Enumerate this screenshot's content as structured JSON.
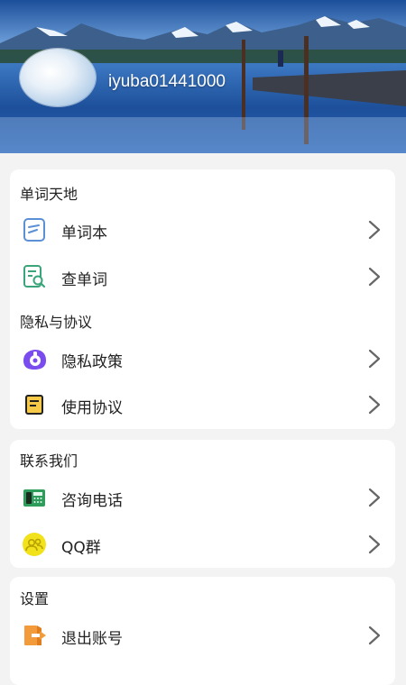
{
  "profile": {
    "username": "iyuba01441000"
  },
  "sections": [
    {
      "title": "单词天地",
      "items": [
        {
          "label": "单词本",
          "icon": "notebook-icon"
        },
        {
          "label": "查单词",
          "icon": "search-word-icon"
        }
      ]
    },
    {
      "title": "隐私与协议",
      "items": [
        {
          "label": "隐私政策",
          "icon": "privacy-icon"
        },
        {
          "label": "使用协议",
          "icon": "agreement-icon"
        }
      ]
    },
    {
      "title": "联系我们",
      "items": [
        {
          "label": "咨询电话",
          "icon": "phone-icon"
        },
        {
          "label": "QQ群",
          "icon": "qq-group-icon"
        }
      ]
    },
    {
      "title": "设置",
      "items": [
        {
          "label": "退出账号",
          "icon": "logout-icon"
        }
      ]
    }
  ],
  "colors": {
    "accent_blue": "#5b8fd6",
    "privacy_purple": "#7a4cf0",
    "qq_yellow": "#f2e21c",
    "logout_orange": "#f39a3a",
    "phone_green": "#2e9c5a"
  }
}
